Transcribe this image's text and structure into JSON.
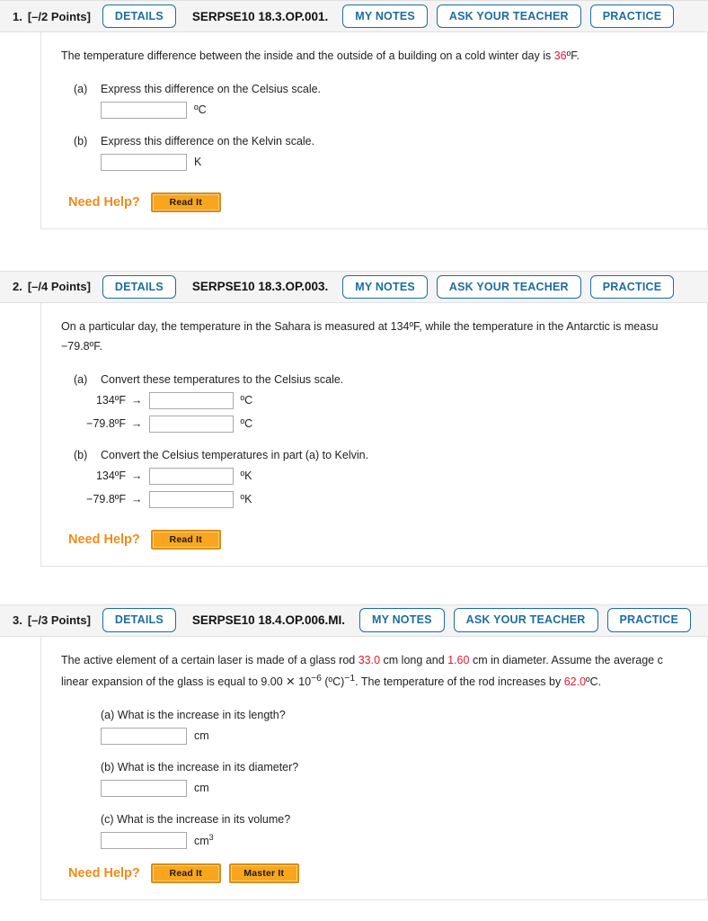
{
  "colors": {
    "accent_blue": "#1d6ca1",
    "highlight_red": "#e8192c",
    "help_orange": "#f08c1b",
    "button_orange": "#f9a61e",
    "header_bg": "#f4f4f4"
  },
  "common": {
    "details_label": "DETAILS",
    "my_notes_label": "MY NOTES",
    "ask_teacher_label": "ASK YOUR TEACHER",
    "practice_label": "PRACTICE",
    "need_help_label": "Need Help?",
    "read_it_label": "Read It",
    "master_it_label": "Master It",
    "arrow": "→"
  },
  "questions": [
    {
      "number": "1.",
      "points": "[–/2 Points]",
      "code": "SERPSE10 18.3.OP.001.",
      "stem_pre": "The temperature difference between the inside and the outside of a building on a cold winter day is ",
      "stem_value": "36",
      "stem_post": "ºF.",
      "parts": [
        {
          "tag": "(a)",
          "text": "Express this difference on the Celsius scale.",
          "rows": [
            {
              "value": "",
              "unit": "ºC"
            }
          ]
        },
        {
          "tag": "(b)",
          "text": "Express this difference on the Kelvin scale.",
          "rows": [
            {
              "value": "",
              "unit": "K"
            }
          ]
        }
      ],
      "help_buttons": [
        "Read It"
      ]
    },
    {
      "number": "2.",
      "points": "[–/4 Points]",
      "code": "SERPSE10 18.3.OP.003.",
      "stem_line1": "On a particular day, the temperature in the Sahara is measured at 134ºF, while the temperature in the Antarctic is measu",
      "stem_line2": "−79.8ºF.",
      "parts": [
        {
          "tag": "(a)",
          "text": "Convert these temperatures to the Celsius scale.",
          "rows": [
            {
              "pre": "134ºF",
              "value": "",
              "unit": "ºC"
            },
            {
              "pre": "−79.8ºF",
              "value": "",
              "unit": "ºC"
            }
          ]
        },
        {
          "tag": "(b)",
          "text": "Convert the Celsius temperatures in part (a) to Kelvin.",
          "rows": [
            {
              "pre": "134ºF",
              "value": "",
              "unit": "ºK"
            },
            {
              "pre": "−79.8ºF",
              "value": "",
              "unit": "ºK"
            }
          ]
        }
      ],
      "help_buttons": [
        "Read It"
      ]
    },
    {
      "number": "3.",
      "points": "[–/3 Points]",
      "code": "SERPSE10 18.4.OP.006.MI.",
      "stem_l1_a": "The active element of a certain laser is made of a glass rod ",
      "stem_l1_v1": "33.0",
      "stem_l1_b": " cm long and ",
      "stem_l1_v2": "1.60",
      "stem_l1_c": " cm in diameter. Assume the average c",
      "stem_l2_a": "linear expansion of the glass is equal to 9.00 ✕ 10",
      "stem_l2_sup1": "−6",
      "stem_l2_b": " (ºC)",
      "stem_l2_sup2": "−1",
      "stem_l2_c": ". The temperature of the rod increases by ",
      "stem_l2_v": "62.0",
      "stem_l2_d": "ºC.",
      "parts": [
        {
          "tag": "(a)",
          "text": "What is the increase in its length?",
          "unit": "cm"
        },
        {
          "tag": "(b)",
          "text": "What is the increase in its diameter?",
          "unit": "cm"
        },
        {
          "tag": "(c)",
          "text": "What is the increase in its volume?",
          "unit": "cm",
          "unit_sup": "3"
        }
      ],
      "help_buttons": [
        "Read It",
        "Master It"
      ]
    }
  ]
}
